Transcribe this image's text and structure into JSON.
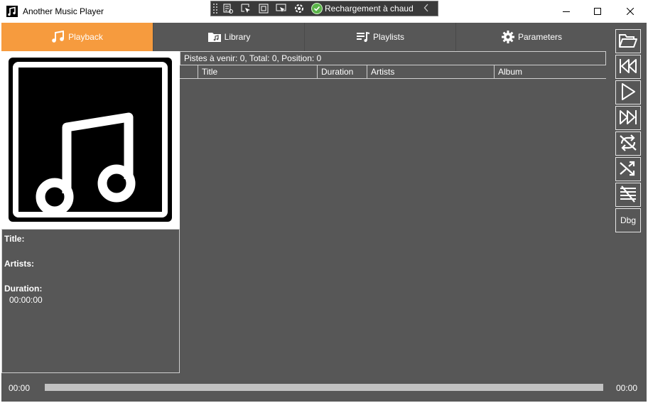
{
  "window": {
    "title": "Another Music Player",
    "controls": [
      "minimize",
      "maximize",
      "close"
    ]
  },
  "devbar": {
    "hot_reload_label": "Rechargement à chaud",
    "tools": [
      "live-visual-tree-icon",
      "select-element-icon",
      "display-layout-adorners-icon",
      "track-focus-icon",
      "binding-failures-icon"
    ]
  },
  "tabs": [
    {
      "label": "Playback",
      "icon": "music-note-icon",
      "active": true
    },
    {
      "label": "Library",
      "icon": "folder-music-icon",
      "active": false
    },
    {
      "label": "Playlists",
      "icon": "playlist-icon",
      "active": false
    },
    {
      "label": "Parameters",
      "icon": "gear-icon",
      "active": false
    }
  ],
  "now_playing": {
    "title_label": "Title:",
    "title_value": "",
    "artists_label": "Artists:",
    "artists_value": "",
    "duration_label": "Duration:",
    "duration_value": "00:00:00"
  },
  "queue": {
    "status": "Pistes à venir:  0, Total:  0, Position: 0",
    "columns": [
      "",
      "Title",
      "Duration",
      "Artists",
      "Album"
    ],
    "rows": []
  },
  "side_buttons": [
    {
      "name": "open-folder-button",
      "icon": "folder-open-icon"
    },
    {
      "name": "previous-button",
      "icon": "previous-icon"
    },
    {
      "name": "play-button",
      "icon": "play-icon"
    },
    {
      "name": "next-button",
      "icon": "next-icon"
    },
    {
      "name": "repeat-button",
      "icon": "repeat-off-icon"
    },
    {
      "name": "shuffle-button",
      "icon": "shuffle-icon"
    },
    {
      "name": "clear-queue-button",
      "icon": "clear-list-icon"
    },
    {
      "name": "debug-button",
      "label": "Dbg"
    }
  ],
  "playback": {
    "elapsed": "00:00",
    "total": "00:00",
    "progress_fraction": 0
  },
  "colors": {
    "accent": "#f69b3e",
    "background": "#575757",
    "border": "#cfcfcf"
  }
}
